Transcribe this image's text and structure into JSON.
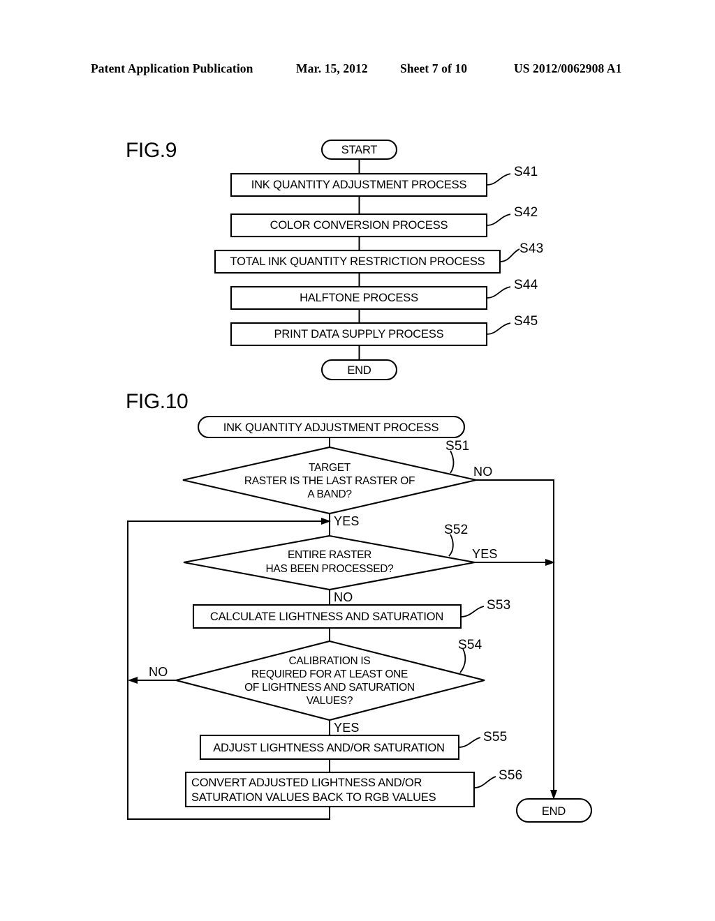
{
  "header": {
    "publication": "Patent Application Publication",
    "date": "Mar. 15, 2012",
    "sheet": "Sheet 7 of 10",
    "document_number": "US 2012/0062908 A1"
  },
  "figures": [
    {
      "title": "FIG.9",
      "start_label": "START",
      "end_label": "END",
      "steps": [
        {
          "id": "S41",
          "text": "INK QUANTITY ADJUSTMENT PROCESS"
        },
        {
          "id": "S42",
          "text": "COLOR CONVERSION PROCESS"
        },
        {
          "id": "S43",
          "text": "TOTAL INK QUANTITY RESTRICTION PROCESS"
        },
        {
          "id": "S44",
          "text": "HALFTONE PROCESS"
        },
        {
          "id": "S45",
          "text": "PRINT DATA SUPPLY PROCESS"
        }
      ]
    },
    {
      "title": "FIG.10",
      "start_label": "INK QUANTITY ADJUSTMENT PROCESS",
      "end_label": "END",
      "steps": [
        {
          "id": "S51",
          "kind": "decision",
          "lines": [
            "TARGET",
            "RASTER IS THE LAST RASTER OF",
            "A BAND?"
          ],
          "branch_right": "NO",
          "branch_bottom": "YES"
        },
        {
          "id": "S52",
          "kind": "decision",
          "lines": [
            "ENTIRE RASTER",
            "HAS BEEN PROCESSED?"
          ],
          "branch_right": "YES",
          "branch_bottom": "NO"
        },
        {
          "id": "S53",
          "kind": "process",
          "lines": [
            "CALCULATE LIGHTNESS AND SATURATION"
          ]
        },
        {
          "id": "S54",
          "kind": "decision",
          "lines": [
            "CALIBRATION IS",
            "REQUIRED FOR AT LEAST ONE",
            "OF LIGHTNESS AND SATURATION",
            "VALUES?"
          ],
          "branch_left": "NO",
          "branch_bottom": "YES"
        },
        {
          "id": "S55",
          "kind": "process",
          "lines": [
            "ADJUST LIGHTNESS AND/OR SATURATION"
          ]
        },
        {
          "id": "S56",
          "kind": "process",
          "lines": [
            "CONVERT ADJUSTED LIGHTNESS AND/OR",
            "SATURATION VALUES BACK TO RGB VALUES"
          ]
        }
      ]
    }
  ]
}
